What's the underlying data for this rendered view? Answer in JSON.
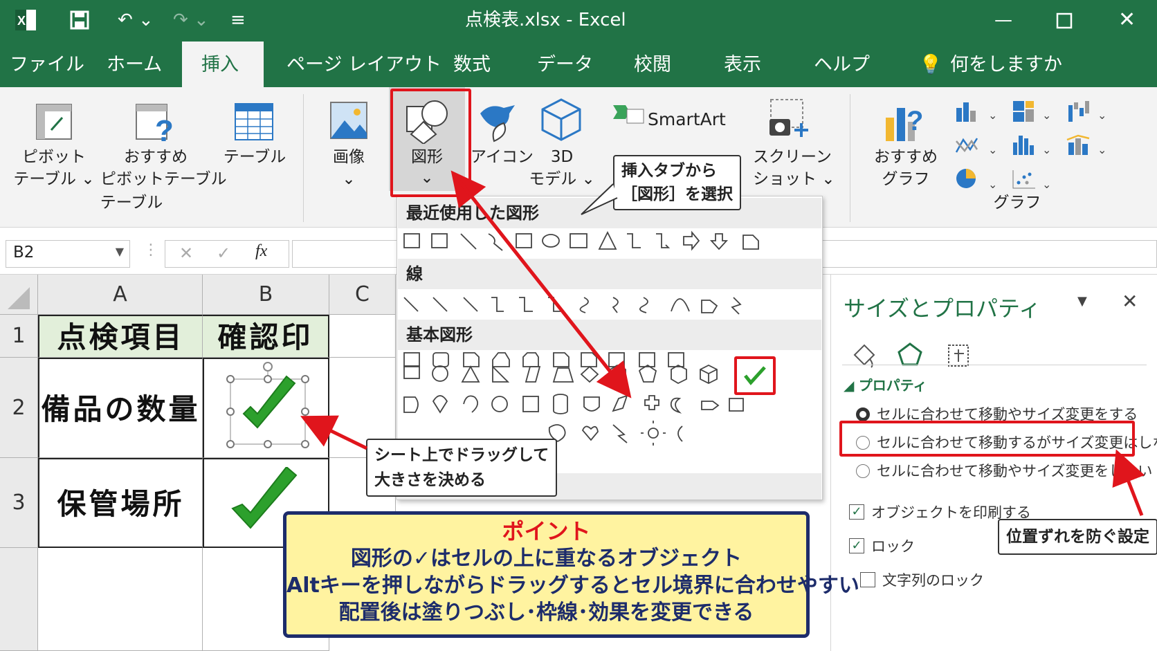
{
  "window": {
    "title": "点検表.xlsx  -  Excel"
  },
  "tabs": [
    "ファイル",
    "ホーム",
    "挿入",
    "ページ レイアウト",
    "数式",
    "データ",
    "校閲",
    "表示",
    "ヘルプ"
  ],
  "tell_me": "何をしますか",
  "ribbon": {
    "pivot": [
      "ピボット",
      "テーブル ⌄"
    ],
    "recommended_pivot": [
      "おすすめ",
      "ピボットテーブル"
    ],
    "table": "テーブル",
    "group_table": "テーブル",
    "image": "画像",
    "shapes": "図形",
    "icon": "アイコン",
    "model3d": [
      "3D",
      "モデル ⌄"
    ],
    "smartart": "SmartArt",
    "screenshot": [
      "スクリーン",
      "ショット ⌄"
    ],
    "recommended_chart": [
      "おすすめ",
      "グラフ"
    ],
    "group_chart": "グラフ"
  },
  "formula": {
    "namebox": "B2",
    "fx": "fx"
  },
  "grid": {
    "columns": [
      "A",
      "B",
      "C"
    ],
    "rows": [
      "1",
      "2",
      "3"
    ],
    "a1": "点検項目",
    "b1": "確認印",
    "a2": "備品の数量",
    "a3": "保管場所"
  },
  "dropdown": {
    "recent": "最近使用した図形",
    "lines": "線",
    "basic": "基本図形"
  },
  "panel": {
    "title": "サイズとプロパティ",
    "section": "プロパティ",
    "radio1": "セルに合わせて移動やサイズ変更をする",
    "radio2": "セルに合わせて移動するがサイズ変更はしない",
    "radio3": "セルに合わせて移動やサイズ変更をしない",
    "check_print": "オブジェクトを印刷する",
    "check_lock": "ロック",
    "check_textlock": "文字列のロック"
  },
  "callouts": {
    "tab_shape": [
      "挿入タブから",
      "［図形］を選択"
    ],
    "drag": [
      "シート上でドラッグして",
      "大きさを決める"
    ],
    "position": "位置ずれを防ぐ設定"
  },
  "point": {
    "heading": "ポイント",
    "lines": [
      "図形の✓はセルの上に重なるオブジェクト",
      "Altキーを押しながらドラッグするとセル境界に合わせやすい",
      "配置後は塗りつぶし･枠線･効果を変更できる"
    ]
  },
  "colors": {
    "excel_green": "#217346",
    "accent_red": "#e0151c",
    "check_green": "#2ca02c",
    "note_yellow": "#fff3a0",
    "note_border": "#1d2c6b"
  }
}
